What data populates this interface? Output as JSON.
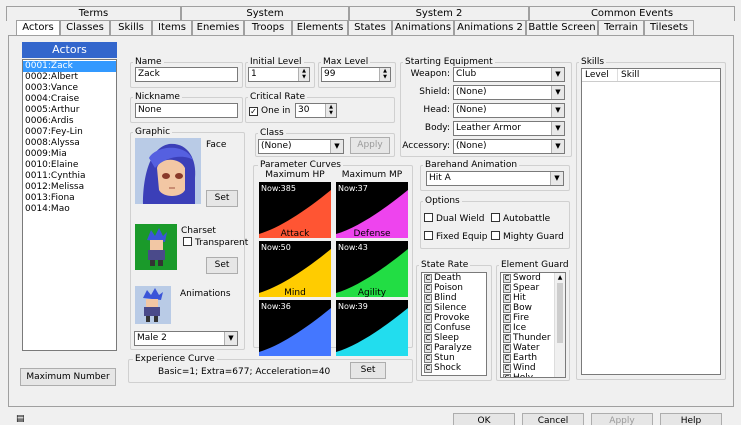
{
  "tabs_top": [
    "Terms",
    "System",
    "System 2",
    "Common Events"
  ],
  "tabs_bottom": [
    "Actors",
    "Classes",
    "Skills",
    "Items",
    "Enemies",
    "Troops",
    "Elements",
    "States",
    "Animations",
    "Animations 2",
    "Battle Screen",
    "Terrain",
    "Tilesets"
  ],
  "actors_panel": {
    "title": "Actors",
    "items": [
      "0001:Zack",
      "0002:Albert",
      "0003:Vance",
      "0004:Craise",
      "0005:Arthur",
      "0006:Ardis",
      "0007:Fey-Lin",
      "0008:Alyssa",
      "0009:Mia",
      "0010:Elaine",
      "0011:Cynthia",
      "0012:Melissa",
      "0013:Fiona",
      "0014:Mao"
    ],
    "max_number_button": "Maximum Number"
  },
  "name": {
    "label": "Name",
    "value": "Zack"
  },
  "nickname": {
    "label": "Nickname",
    "value": "None"
  },
  "initial_level": {
    "label": "Initial Level",
    "value": "1"
  },
  "max_level": {
    "label": "Max Level",
    "value": "99"
  },
  "critical_rate": {
    "label": "Critical Rate",
    "checkbox_label": "One in",
    "value": "30",
    "checked": true
  },
  "graphic": {
    "label": "Graphic",
    "face_label": "Face",
    "face_set": "Set",
    "charset_label": "Charset",
    "transparent_label": "Transparent",
    "charset_set": "Set",
    "animations_label": "Animations",
    "animation_value": "Male 2"
  },
  "class": {
    "label": "Class",
    "value": "(None)",
    "apply": "Apply"
  },
  "parameter_curves": {
    "label": "Parameter Curves",
    "curves": [
      {
        "name": "Maximum HP",
        "now": "Now:385",
        "color": "#ff5533"
      },
      {
        "name": "Maximum MP",
        "now": "Now:37",
        "color": "#ee44ee"
      },
      {
        "name": "Attack",
        "now": "Now:50",
        "color": "#ffcc00"
      },
      {
        "name": "Defense",
        "now": "Now:43",
        "color": "#22dd44"
      },
      {
        "name": "Mind",
        "now": "Now:36",
        "color": "#4477ff"
      },
      {
        "name": "Agility",
        "now": "Now:39",
        "color": "#22ddee"
      }
    ]
  },
  "starting_equipment": {
    "label": "Starting Equipment",
    "rows": [
      {
        "label": "Weapon:",
        "value": "Club"
      },
      {
        "label": "Shield:",
        "value": "(None)"
      },
      {
        "label": "Head:",
        "value": "(None)"
      },
      {
        "label": "Body:",
        "value": "Leather Armor"
      },
      {
        "label": "Accessory:",
        "value": "(None)"
      }
    ]
  },
  "barehand_animation": {
    "label": "Barehand Animation",
    "value": "Hit A"
  },
  "options": {
    "label": "Options",
    "items": [
      "Dual Wield",
      "Autobattle",
      "Fixed Equip",
      "Mighty Guard"
    ]
  },
  "state_rate": {
    "label": "State Rate",
    "rank": "C",
    "items": [
      "Death",
      "Poison",
      "Blind",
      "Silence",
      "Provoke",
      "Confuse",
      "Sleep",
      "Paralyze",
      "Stun",
      "Shock"
    ]
  },
  "element_guard": {
    "label": "Element Guard",
    "rank": "C",
    "items": [
      "Sword",
      "Spear",
      "Hit",
      "Bow",
      "Fire",
      "Ice",
      "Thunder",
      "Water",
      "Earth",
      "Wind",
      "Holy"
    ]
  },
  "skills": {
    "label": "Skills",
    "col_level": "Level",
    "col_skill": "Skill"
  },
  "experience_curve": {
    "label": "Experience Curve",
    "value": "Basic=1; Extra=677; Acceleration=40",
    "set": "Set"
  },
  "footer": {
    "ok": "OK",
    "cancel": "Cancel",
    "apply": "Apply",
    "help": "Help"
  }
}
